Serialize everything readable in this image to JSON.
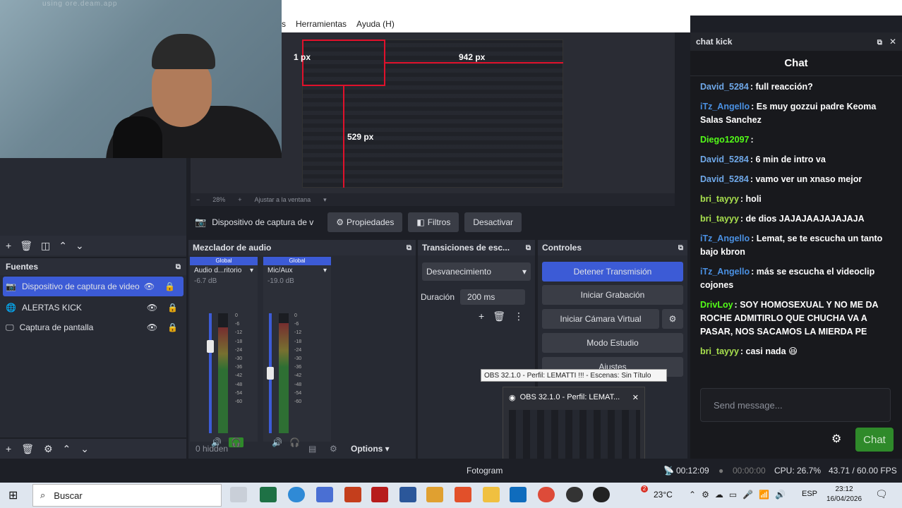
{
  "menubar": {
    "item_s": "s",
    "herramientas": "Herramientas",
    "ayuda": "Ayuda (H)"
  },
  "webcam": {
    "watermark": "using ore.deam.app"
  },
  "preview": {
    "px_left": "1 px",
    "px_right": "942 px",
    "px_bottom": "529 px"
  },
  "zoom": {
    "minus": "−",
    "value": "28%",
    "plus": "+",
    "fit": "Ajustar a la ventana"
  },
  "source_toolbar": {
    "source": "Dispositivo de captura de v",
    "properties": "Propiedades",
    "filters": "Filtros",
    "deactivate": "Desactivar"
  },
  "fuentes": {
    "title": "Fuentes",
    "items": [
      {
        "label": "Dispositivo de captura de video"
      },
      {
        "label": "ALERTAS KICK"
      },
      {
        "label": "Captura de pantalla"
      }
    ]
  },
  "mixer": {
    "title": "Mezclador de audio",
    "channels": [
      {
        "global": "Global",
        "name": "Audio d...ritorio",
        "db": "-6.7 dB"
      },
      {
        "global": "Global",
        "name": "Mic/Aux",
        "db": "-19.0 dB"
      }
    ],
    "scale": [
      "0",
      "-6",
      "-12",
      "-18",
      "-24",
      "-30",
      "-36",
      "-42",
      "-48",
      "-54",
      "-60"
    ],
    "hidden": "0 hidden",
    "options": "Options"
  },
  "transitions": {
    "title": "Transiciones de esc...",
    "type": "Desvanecimiento",
    "duration_label": "Duración",
    "duration_value": "200 ms"
  },
  "controls": {
    "title": "Controles",
    "stop_stream": "Detener Transmisión",
    "start_recording": "Iniciar Grabación",
    "virtual_cam": "Iniciar Cámara Virtual",
    "studio_mode": "Modo Estudio",
    "settings": "Ajustes"
  },
  "tooltip": "OBS 32.1.0 - Perfil: LEMATTI !!! - Escenas: Sin Título",
  "thumbnail": {
    "title": "OBS 32.1.0 - Perfil: LEMAT..."
  },
  "chat": {
    "dock_title": "chat kick",
    "header": "Chat",
    "messages": [
      {
        "user": "David_5284",
        "color": "#6fa8e8",
        "text": "full reacción?"
      },
      {
        "user": "iTz_Angello",
        "color": "#4a90e2",
        "text": "Es muy gozzui padre Keoma Salas Sanchez"
      },
      {
        "user": "Diego12097",
        "color": "#53fc18",
        "text": ""
      },
      {
        "user": "David_5284",
        "color": "#6fa8e8",
        "text": "6 min de intro va"
      },
      {
        "user": "David_5284",
        "color": "#6fa8e8",
        "text": "vamo ver un xnaso mejor"
      },
      {
        "user": "bri_tayyy",
        "color": "#a8e04e",
        "text": "holi"
      },
      {
        "user": "bri_tayyy",
        "color": "#a8e04e",
        "text": "de dios JAJAJAAJAJAJAJA"
      },
      {
        "user": "iTz_Angello",
        "color": "#4a90e2",
        "text": "Lemat, se te escucha un tanto bajo kbron"
      },
      {
        "user": "iTz_Angello",
        "color": "#4a90e2",
        "text": "más se escucha el videoclip cojones"
      },
      {
        "user": "DrivLoy",
        "color": "#53fc18",
        "text": "SOY HOMOSEXUAL Y NO ME DA ROCHE ADMITIRLO QUE CHUCHA VA A PASAR, NOS SACAMOS LA MIERDA PE"
      },
      {
        "user": "bri_tayyy",
        "color": "#a8e04e",
        "text": "casi nada 😆"
      }
    ],
    "input_placeholder": "Send message...",
    "send": "Chat"
  },
  "status": {
    "fotogramas": "Fotogram",
    "stream_time": "00:12:09",
    "rec_time": "00:00:00",
    "cpu": "CPU: 26.7%",
    "fps": "43.71 / 60.00 FPS"
  },
  "taskbar": {
    "search": "Buscar",
    "temp": "23°C",
    "notif": "2",
    "lang": "ESP",
    "time": "23:12",
    "date": "16/04/2026"
  },
  "colors": {
    "accent": "#3c5bd6",
    "kick_green": "#53fc18",
    "red_guide": "#e0112b"
  }
}
